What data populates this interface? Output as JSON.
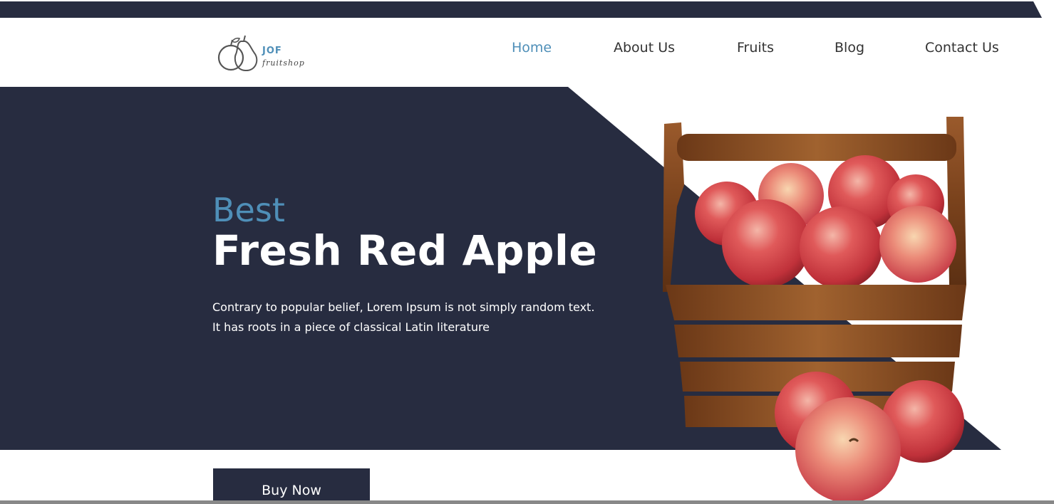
{
  "colors": {
    "dark_navy": "#272c40",
    "accent_blue": "#4f8fb8",
    "text_dark": "#333333",
    "white": "#ffffff"
  },
  "logo": {
    "name": "JOF",
    "subtitle": "fruitshop",
    "icon": "apple-pear-outline-icon"
  },
  "nav": {
    "items": [
      {
        "label": "Home",
        "active": true
      },
      {
        "label": "About Us",
        "active": false
      },
      {
        "label": "Fruits",
        "active": false
      },
      {
        "label": "Blog",
        "active": false
      },
      {
        "label": "Contact Us",
        "active": false
      }
    ]
  },
  "hero": {
    "kicker": "Best",
    "title": "Fresh Red Apple",
    "description": "Contrary to popular belief, Lorem Ipsum is not simply random text. It has roots in a piece of classical Latin literature",
    "button_label": "Buy Now",
    "image": "wooden-basket-red-apples"
  }
}
